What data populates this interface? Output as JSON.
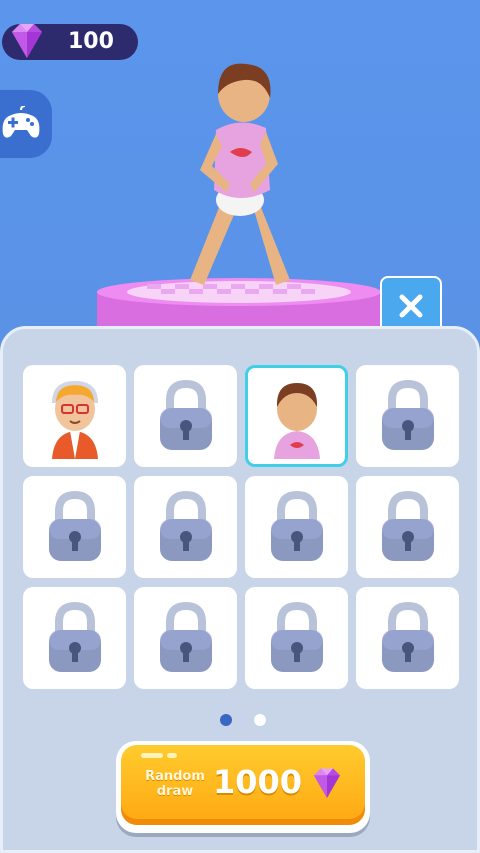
{
  "hud": {
    "gem_count": "100",
    "gem_icon": "purple-diamond",
    "gamepad_icon": "gamepad-icon",
    "close_icon": "close-icon"
  },
  "skins": [
    {
      "name": "blonde-glasses-character",
      "state": "unlocked"
    },
    {
      "name": "locked",
      "state": "locked"
    },
    {
      "name": "brown-hair-character",
      "state": "selected"
    },
    {
      "name": "locked",
      "state": "locked"
    },
    {
      "name": "locked",
      "state": "locked"
    },
    {
      "name": "locked",
      "state": "locked"
    },
    {
      "name": "locked",
      "state": "locked"
    },
    {
      "name": "locked",
      "state": "locked"
    },
    {
      "name": "locked",
      "state": "locked"
    },
    {
      "name": "locked",
      "state": "locked"
    },
    {
      "name": "locked",
      "state": "locked"
    },
    {
      "name": "locked",
      "state": "locked"
    }
  ],
  "pagination": {
    "pages": 2,
    "current": 1
  },
  "draw": {
    "label": "Random draw",
    "cost": "1000"
  },
  "colors": {
    "background": "#5a95ea",
    "selected_border": "#3fd0e6",
    "button": "#ffb81c",
    "gem": "#b43be0"
  }
}
